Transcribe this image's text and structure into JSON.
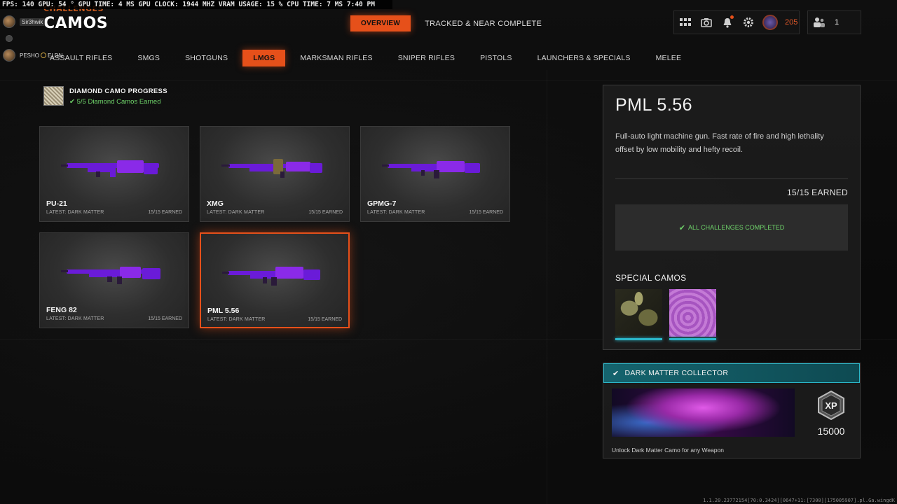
{
  "perf": "FPS: 140  GPU: 54 °  GPU TIME:  4 MS  GPU CLOCK: 1944 MHZ  VRAM USAGE: 15 %  CPU TIME:  7 MS  7:40 PM",
  "header": {
    "subtitle": "CHALLENGES",
    "title": "CAMOS"
  },
  "party": {
    "member1": "Sir3hwik",
    "member2_tag": "PESHO",
    "member2_clan": "ELDN"
  },
  "top_tabs": {
    "overview": "OVERVIEW",
    "tracked": "TRACKED & NEAR COMPLETE"
  },
  "hud": {
    "level": "205",
    "party_count": "1"
  },
  "categories": [
    "ASSAULT RIFLES",
    "SMGS",
    "SHOTGUNS",
    "LMGS",
    "MARKSMAN RIFLES",
    "SNIPER RIFLES",
    "PISTOLS",
    "LAUNCHERS & SPECIALS",
    "MELEE"
  ],
  "active_category": "LMGS",
  "diamond": {
    "title": "DIAMOND CAMO PROGRESS",
    "status": "5/5 Diamond Camos Earned"
  },
  "weapons": [
    {
      "name": "PU-21",
      "latest": "LATEST: DARK MATTER",
      "earned": "15/15 EARNED"
    },
    {
      "name": "XMG",
      "latest": "LATEST: DARK MATTER",
      "earned": "15/15 EARNED"
    },
    {
      "name": "GPMG-7",
      "latest": "LATEST: DARK MATTER",
      "earned": "15/15 EARNED"
    },
    {
      "name": "FENG 82",
      "latest": "LATEST: DARK MATTER",
      "earned": "15/15 EARNED"
    },
    {
      "name": "PML 5.56",
      "latest": "LATEST: DARK MATTER",
      "earned": "15/15 EARNED"
    }
  ],
  "detail": {
    "title": "PML 5.56",
    "description": "Full-auto light machine gun.  Fast rate of fire and high lethality offset by low mobility and hefty recoil.",
    "earned": "15/15 EARNED",
    "complete": "ALL CHALLENGES COMPLETED",
    "special_label": "SPECIAL CAMOS"
  },
  "challenge": {
    "title": "DARK MATTER COLLECTOR",
    "xp": "15000",
    "description": "Unlock Dark Matter Camo for any Weapon"
  },
  "footer": "1.1.20.23772154[70:0.3424][0647+11:[7300][175005907].pl.Ga.wingdK"
}
